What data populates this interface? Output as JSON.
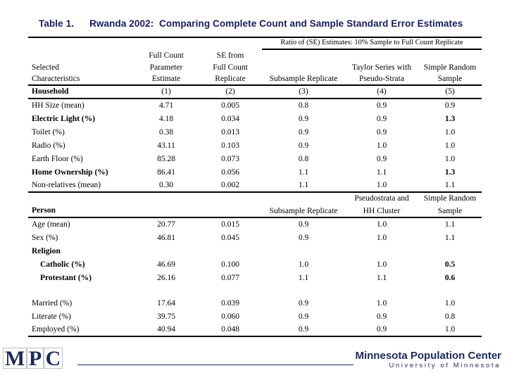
{
  "title": {
    "table_number": "Table 1.",
    "text": "Rwanda 2002:  Comparing Complete Count and Sample Standard Error Estimates",
    "color": "#171a5e"
  },
  "table": {
    "stub_header": {
      "line1": "Selected",
      "line2": "Characteristics"
    },
    "spanner": "Ratio of (SE) Estimates: 10% Sample to Full Count Replicate",
    "column_headers": [
      {
        "line1": "Full Count",
        "line2": "Parameter",
        "line3": "Estimate"
      },
      {
        "line1": "SE from",
        "line2": "Full Count",
        "line3": "Replicate"
      },
      {
        "line1": "",
        "line2": "",
        "line3": "Subsample Replicate"
      },
      {
        "line1": "",
        "line2": "Taylor Series with",
        "line3": "Pseudo-Strata"
      },
      {
        "line1": "",
        "line2": "Simple Random",
        "line3": "Sample"
      }
    ],
    "column_numbers": [
      "(1)",
      "(2)",
      "(3)",
      "(4)",
      "(5)"
    ],
    "sections": [
      {
        "name": "Household",
        "rows": [
          {
            "label": "HH Size (mean)",
            "label_bold": false,
            "values": [
              "4.71",
              "0.005",
              "0.8",
              "0.9",
              "0.9"
            ],
            "bold_values": [
              false,
              false,
              false,
              false,
              false
            ]
          },
          {
            "label": "Electric Light (%)",
            "label_bold": true,
            "values": [
              "4.18",
              "0.034",
              "0.9",
              "0.9",
              "1.3"
            ],
            "bold_values": [
              false,
              false,
              false,
              false,
              true
            ]
          },
          {
            "label": "Toilet (%)",
            "label_bold": false,
            "values": [
              "0.38",
              "0.013",
              "0.9",
              "0.9",
              "1.0"
            ],
            "bold_values": [
              false,
              false,
              false,
              false,
              false
            ]
          },
          {
            "label": "Radio (%)",
            "label_bold": false,
            "values": [
              "43.11",
              "0.103",
              "0.9",
              "1.0",
              "1.0"
            ],
            "bold_values": [
              false,
              false,
              false,
              false,
              false
            ]
          },
          {
            "label": "Earth Floor (%)",
            "label_bold": false,
            "values": [
              "85.28",
              "0.073",
              "0.8",
              "0.9",
              "1.0"
            ],
            "bold_values": [
              false,
              false,
              false,
              false,
              false
            ]
          },
          {
            "label": "Home Ownership (%)",
            "label_bold": true,
            "values": [
              "86.41",
              "0.056",
              "1.1",
              "1.1",
              "1.3"
            ],
            "bold_values": [
              false,
              false,
              false,
              false,
              true
            ]
          },
          {
            "label": "Non-relatives (mean)",
            "label_bold": false,
            "values": [
              "0.30",
              "0.002",
              "1.1",
              "1.0",
              "1.1"
            ],
            "bold_values": [
              false,
              false,
              false,
              false,
              false
            ]
          }
        ]
      },
      {
        "name": "Person",
        "sub_headers": [
          {
            "line1": "",
            "line2": "Subsample Replicate"
          },
          {
            "line1": "Pseudostrata and",
            "line2": "HH Cluster"
          },
          {
            "line1": "Simple Random",
            "line2": "Sample"
          }
        ],
        "rows": [
          {
            "label": "Age (mean)",
            "label_bold": false,
            "indent": false,
            "values": [
              "20.77",
              "0.015",
              "0.9",
              "1.0",
              "1.1"
            ],
            "bold_values": [
              false,
              false,
              false,
              false,
              false
            ]
          },
          {
            "label": "Sex (%)",
            "label_bold": false,
            "indent": false,
            "values": [
              "46.81",
              "0.045",
              "0.9",
              "1.0",
              "1.1"
            ],
            "bold_values": [
              false,
              false,
              false,
              false,
              false
            ]
          },
          {
            "label": "Religion",
            "label_bold": true,
            "indent": false,
            "values": [
              "",
              "",
              "",
              "",
              ""
            ],
            "bold_values": [
              false,
              false,
              false,
              false,
              false
            ]
          },
          {
            "label": "Catholic (%)",
            "label_bold": true,
            "indent": true,
            "values": [
              "46.69",
              "0.100",
              "1.0",
              "1.0",
              "0.5"
            ],
            "bold_values": [
              false,
              false,
              false,
              false,
              true
            ]
          },
          {
            "label": "Protestant (%)",
            "label_bold": true,
            "indent": true,
            "values": [
              "26.16",
              "0.077",
              "1.1",
              "1.1",
              "0.6"
            ],
            "bold_values": [
              false,
              false,
              false,
              false,
              true
            ]
          },
          {
            "label": "",
            "label_bold": false,
            "indent": false,
            "values": [
              "",
              "",
              "",
              "",
              ""
            ],
            "bold_values": [
              false,
              false,
              false,
              false,
              false
            ]
          },
          {
            "label": "Married (%)",
            "label_bold": false,
            "indent": false,
            "values": [
              "17.64",
              "0.039",
              "0.9",
              "1.0",
              "1.0"
            ],
            "bold_values": [
              false,
              false,
              false,
              false,
              false
            ]
          },
          {
            "label": "Literate (%)",
            "label_bold": false,
            "indent": false,
            "values": [
              "39.75",
              "0.060",
              "0.9",
              "0.9",
              "0.8"
            ],
            "bold_values": [
              false,
              false,
              false,
              false,
              false
            ]
          },
          {
            "label": "Employed (%)",
            "label_bold": false,
            "indent": false,
            "values": [
              "40.94",
              "0.048",
              "0.9",
              "0.9",
              "1.0"
            ],
            "bold_values": [
              false,
              false,
              false,
              false,
              false
            ]
          }
        ]
      }
    ]
  },
  "footer": {
    "mpc_letters": [
      "M",
      "P",
      "C"
    ],
    "umn_line1": "Minnesota Population Center",
    "umn_line2": "University of Minnesota",
    "brand_color": "#1b2a57"
  }
}
